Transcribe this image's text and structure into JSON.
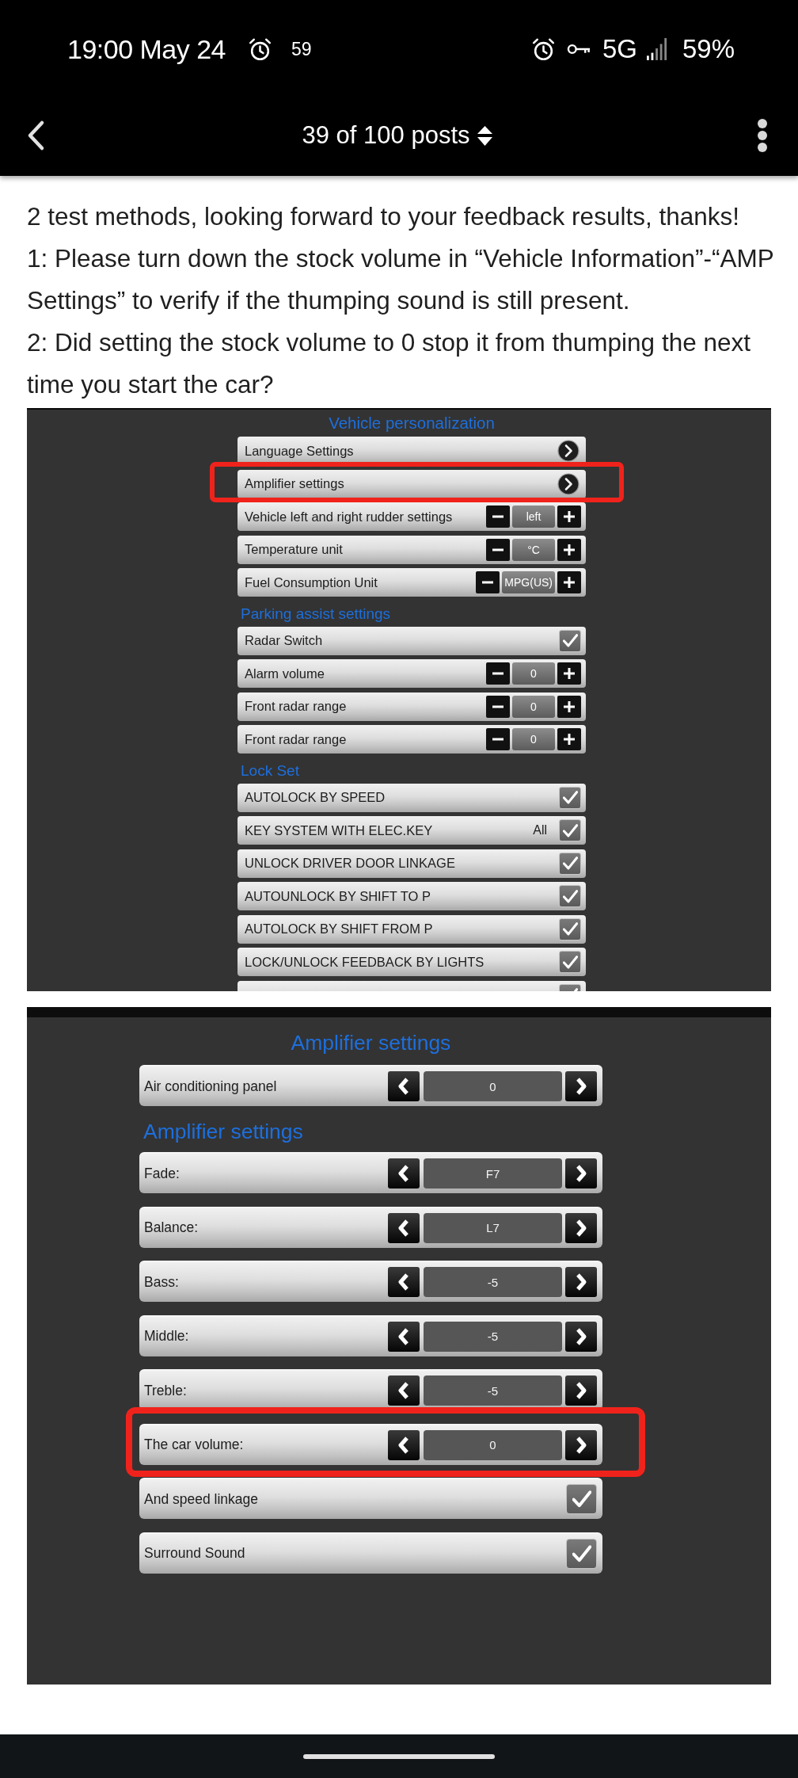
{
  "status_bar": {
    "time": "19:00 May 24",
    "notification_count": "59",
    "network": "5G",
    "battery": "59%"
  },
  "header": {
    "title": "39 of 100 posts"
  },
  "post": {
    "paragraphs": [
      "2 test methods, looking forward to your feedback results, thanks!",
      "1: Please turn down the stock volume in “Vehicle Information”-“AMP Settings” to verify if the thumping sound is still present.",
      "2: Did setting the stock volume to 0 stop it from thumping the next time you start the car?"
    ]
  },
  "screenshots": [
    {
      "title": "Vehicle personalization",
      "sections": [
        {
          "rows": [
            {
              "kind": "link",
              "label": "Language Settings",
              "highlighted": false
            },
            {
              "kind": "link",
              "label": "Amplifier settings",
              "highlighted": true
            },
            {
              "kind": "stepper",
              "label": "Vehicle left and right rudder settings",
              "value": "left",
              "highlighted": false
            },
            {
              "kind": "stepper",
              "label": "Temperature unit",
              "value": "°C",
              "highlighted": false
            },
            {
              "kind": "stepper",
              "label": "Fuel Consumption Unit",
              "value": "MPG(US)",
              "highlighted": false
            }
          ]
        },
        {
          "heading": "Parking assist settings",
          "rows": [
            {
              "kind": "check",
              "label": "Radar Switch",
              "checked": true,
              "highlighted": false
            },
            {
              "kind": "stepper",
              "label": "Alarm volume",
              "value": "0",
              "highlighted": false
            },
            {
              "kind": "stepper",
              "label": "Front radar range",
              "value": "0",
              "highlighted": false
            },
            {
              "kind": "stepper",
              "label": "Front radar range",
              "value": "0",
              "highlighted": false
            }
          ]
        },
        {
          "heading": "Lock Set",
          "rows": [
            {
              "kind": "check",
              "label": "AUTOLOCK BY SPEED",
              "checked": true,
              "highlighted": false
            },
            {
              "kind": "check",
              "label": "KEY SYSTEM WITH ELEC.KEY",
              "value": "All",
              "checked": true,
              "highlighted": false
            },
            {
              "kind": "check",
              "label": "UNLOCK DRIVER DOOR LINKAGE",
              "checked": true,
              "highlighted": false
            },
            {
              "kind": "check",
              "label": "AUTOUNLOCK BY SHIFT TO P",
              "checked": true,
              "highlighted": false
            },
            {
              "kind": "check",
              "label": "AUTOLOCK BY SHIFT FROM P",
              "checked": true,
              "highlighted": false
            },
            {
              "kind": "check",
              "label": "LOCK/UNLOCK FEEDBACK BY LIGHTS",
              "checked": true,
              "highlighted": false
            },
            {
              "kind": "check",
              "checked": true,
              "highlighted": false
            }
          ]
        }
      ]
    },
    {
      "title": "Amplifier settings",
      "sections": [
        {
          "rows": [
            {
              "kind": "selector",
              "label": "Air conditioning panel",
              "value": "0",
              "highlighted": false
            }
          ]
        },
        {
          "heading": "Amplifier settings",
          "rows": [
            {
              "kind": "selector",
              "label": "Fade:",
              "value": "F7",
              "highlighted": false
            },
            {
              "kind": "selector",
              "label": "Balance:",
              "value": "L7",
              "highlighted": false
            },
            {
              "kind": "selector",
              "label": "Bass:",
              "value": "-5",
              "highlighted": false
            },
            {
              "kind": "selector",
              "label": "Middle:",
              "value": "-5",
              "highlighted": false
            },
            {
              "kind": "selector",
              "label": "Treble:",
              "value": "-5",
              "highlighted": false
            },
            {
              "kind": "selector",
              "label": "The car volume:",
              "value": "0",
              "highlighted": true
            },
            {
              "kind": "check",
              "label": "And speed linkage",
              "checked": true,
              "highlighted": false
            },
            {
              "kind": "check",
              "label": "Surround Sound",
              "checked": true,
              "highlighted": false
            }
          ]
        }
      ]
    }
  ]
}
